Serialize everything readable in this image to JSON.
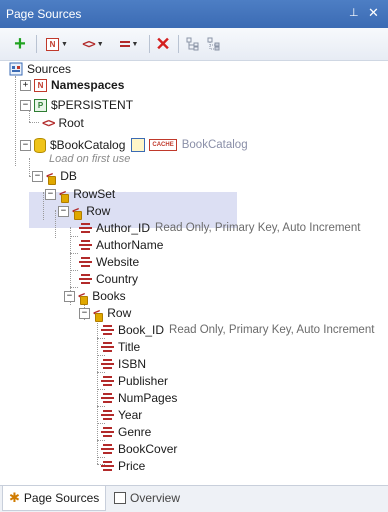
{
  "title_bar": {
    "title": "Page Sources",
    "pin_glyph": "⊥",
    "close_glyph": "✕"
  },
  "toolbar": {
    "buttons": [
      {
        "name": "add-source-button",
        "icon": "plus-icon"
      },
      {
        "name": "add-namespace-button",
        "icon": "namespace-icon"
      },
      {
        "name": "add-element-button",
        "icon": "element-icon"
      },
      {
        "name": "add-attribute-button",
        "icon": "attribute-icon"
      },
      {
        "name": "delete-button",
        "icon": "red-x-icon"
      },
      {
        "name": "structure-button-1",
        "icon": "structure-icon"
      },
      {
        "name": "structure-button-2",
        "icon": "structure-icon"
      }
    ]
  },
  "tree": {
    "sources": "Sources",
    "namespaces": "Namespaces",
    "persistent": "$PERSISTENT",
    "root": "Root",
    "bookcatalog": "$BookCatalog",
    "cache_label": "CACHE",
    "bookcatalog_ref": "BookCatalog",
    "load_hint": "Load on first use",
    "db": "DB",
    "rowset": "RowSet",
    "row": "Row",
    "author_id": "Author_ID",
    "author_id_info": "Read Only, Primary Key, Auto Increment",
    "authorname": "AuthorName",
    "website": "Website",
    "country": "Country",
    "books": "Books",
    "books_row": "Row",
    "book_id": "Book_ID",
    "book_id_info": "Read Only, Primary Key, Auto Increment",
    "title": "Title",
    "isbn": "ISBN",
    "publisher": "Publisher",
    "numpages": "NumPages",
    "year": "Year",
    "genre": "Genre",
    "bookcover": "BookCover",
    "price": "Price"
  },
  "tabs": {
    "page_sources": "Page Sources",
    "overview": "Overview",
    "active": "page_sources"
  },
  "colors": {
    "titlebar": "#3b6bb4",
    "selection": "#dcdff3",
    "accent_red": "#b22a2a"
  }
}
